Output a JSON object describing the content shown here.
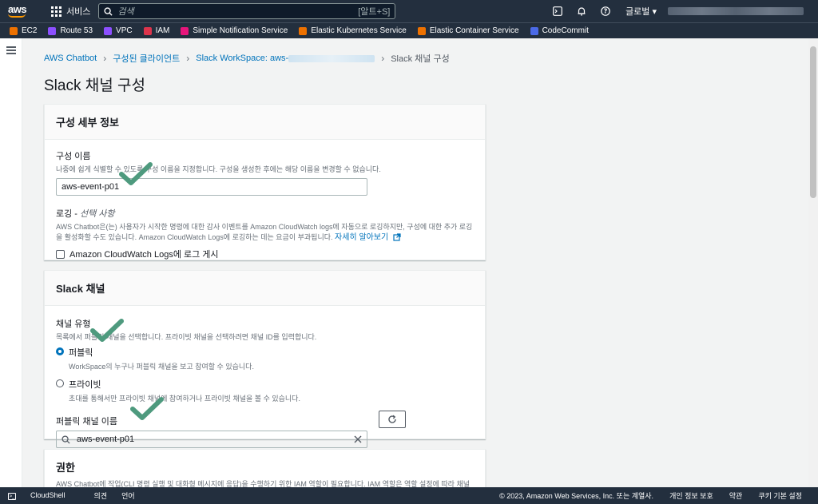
{
  "topnav": {
    "logo": "aws",
    "services_label": "서비스",
    "search_placeholder": "검색",
    "search_shortcut": "[알트+S]",
    "region_label": "글로벌 ▾"
  },
  "favorites": [
    {
      "label": "EC2",
      "color": "#ed7100"
    },
    {
      "label": "Route 53",
      "color": "#8c4fff"
    },
    {
      "label": "VPC",
      "color": "#8c4fff"
    },
    {
      "label": "IAM",
      "color": "#dd344c"
    },
    {
      "label": "Simple Notification Service",
      "color": "#e7157b"
    },
    {
      "label": "Elastic Kubernetes Service",
      "color": "#ed7100"
    },
    {
      "label": "Elastic Container Service",
      "color": "#ed7100"
    },
    {
      "label": "CodeCommit",
      "color": "#4b6ae8"
    }
  ],
  "breadcrumb": {
    "item1": "AWS Chatbot",
    "item2": "구성된 클라이언트",
    "item3": "Slack WorkSpace: aws-",
    "current": "Slack 채널 구성"
  },
  "page_title": "Slack 채널 구성",
  "config_panel": {
    "title": "구성 세부 정보",
    "name_label": "구성 이름",
    "name_desc": "나중에 쉽게 식별할 수 있도록 구성 이름을 지정합니다. 구성을 생성한 후에는 해당 이름을 변경할 수 없습니다.",
    "name_value": "aws-event-p01",
    "logging_label": "로깅 - ",
    "logging_optional": "선택 사항",
    "logging_desc": "AWS Chatbot은(는) 사용자가 시작한 명령에 대한 감사 이벤트를 Amazon CloudWatch logs에 자동으로 로깅하지만, 구성에 대한 추가 로깅을 활성화할 수도 있습니다. Amazon CloudWatch Logs에 로깅하는 데는 요금이 부과됩니다.",
    "learn_more": "자세히 알아보기",
    "checkbox_label": "Amazon CloudWatch Logs에 로그 게시"
  },
  "slack_panel": {
    "title": "Slack 채널",
    "type_label": "채널 유형",
    "type_desc": "목록에서 퍼블릭 채널을 선택합니다. 프라이빗 채널을 선택하려면 채널 ID를 입력합니다.",
    "public_label": "퍼블릭",
    "public_desc": "WorkSpace의 누구나 퍼블릭 채널을 보고 참여할 수 있습니다.",
    "private_label": "프라이빗",
    "private_desc": "초대를 통해서만 프라이빗 채널에 참여하거나 프라이빗 채널을 볼 수 있습니다.",
    "public_name_label": "퍼블릭 채널 이름",
    "public_name_value": "aws-event-p01"
  },
  "perm_panel": {
    "title": "권한",
    "desc": "AWS Chatbot에 작업(CLI 명령 실행 및 대화형 메시지에 응답)을 수행하기 위한 IAM 역할이 필요합니다. IAM 역할은 역할 설정에 따라 채널 IAM 역할 또는 사용자 역할일 수 있습니다. 두 역할 유형 모두 채널 멤버가 보유한 권한을 나타냅니다. 채널 가드 레일은 채널 멤버가 수행할 수 있는"
  },
  "footer": {
    "cloudshell": "CloudShell",
    "feedback": "의견",
    "language": "언어",
    "copyright": "© 2023, Amazon Web Services, Inc. 또는 계열사.",
    "privacy": "개인 정보 보호",
    "terms": "약관",
    "cookies": "쿠키 기본 설정"
  },
  "colors": {
    "nav_bg": "#232f3e",
    "link": "#0073bb",
    "check_overlay": "#4e9a7e",
    "radio_selected": "#0073bb"
  }
}
